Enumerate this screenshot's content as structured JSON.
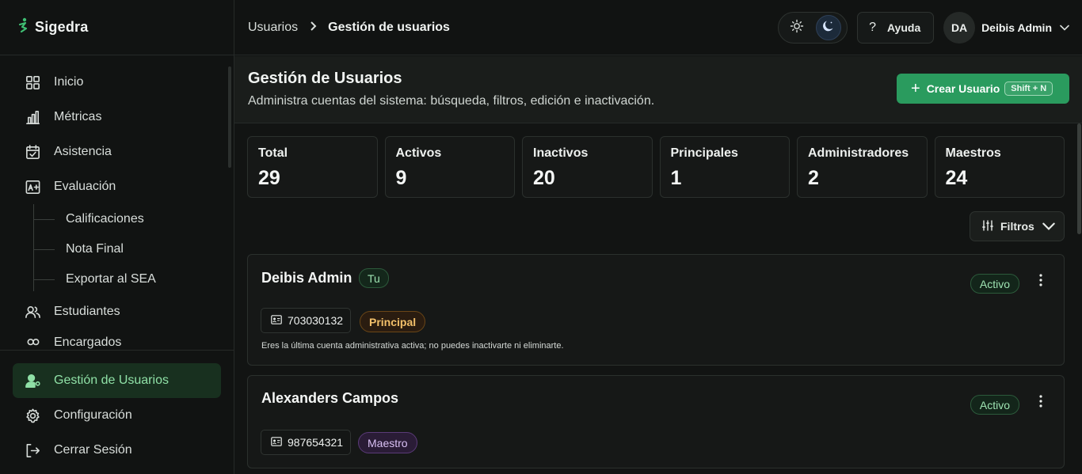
{
  "brand": {
    "name": "Sigedra"
  },
  "sidebar": {
    "items": [
      {
        "label": "Inicio",
        "icon": "grid-icon"
      },
      {
        "label": "Métricas",
        "icon": "bar-chart-icon"
      },
      {
        "label": "Asistencia",
        "icon": "calendar-check-icon"
      },
      {
        "label": "Evaluación",
        "icon": "grade-icon"
      }
    ],
    "evaluacion_sub": [
      "Calificaciones",
      "Nota Final",
      "Exportar al SEA"
    ],
    "estudiantes": "Estudiantes",
    "partial_item": "Encargados",
    "bottom": {
      "users": "Gestión de Usuarios",
      "config": "Configuración",
      "logout": "Cerrar Sesión"
    }
  },
  "topbar": {
    "breadcrumb_parent": "Usuarios",
    "breadcrumb_current": "Gestión de usuarios",
    "help": "Ayuda",
    "help_icon": "?",
    "user_initials": "DA",
    "user_name": "Deibis Admin"
  },
  "page": {
    "title": "Gestión de Usuarios",
    "subtitle": "Administra cuentas del sistema: búsqueda, filtros, edición e inactivación.",
    "create_label": "Crear Usuario",
    "create_shortcut": "Shift + N"
  },
  "stats": [
    {
      "label": "Total",
      "value": "29"
    },
    {
      "label": "Activos",
      "value": "9"
    },
    {
      "label": "Inactivos",
      "value": "20"
    },
    {
      "label": "Principales",
      "value": "1"
    },
    {
      "label": "Administradores",
      "value": "2"
    },
    {
      "label": "Maestros",
      "value": "24"
    }
  ],
  "filters_label": "Filtros",
  "users": [
    {
      "name": "Deibis Admin",
      "self_badge": "Tu",
      "status": "Activo",
      "id": "703030132",
      "role": "Principal",
      "note": "Eres la última cuenta administrativa activa; no puedes inactivarte ni eliminarte."
    },
    {
      "name": "Alexanders Campos",
      "status": "Activo",
      "id": "987654321",
      "role": "Maestro"
    }
  ],
  "colors": {
    "accent": "#2a9b5e",
    "active_nav": "#8fe0a6",
    "principal": "#f3c06a",
    "maestro": "#d9c0f4"
  }
}
